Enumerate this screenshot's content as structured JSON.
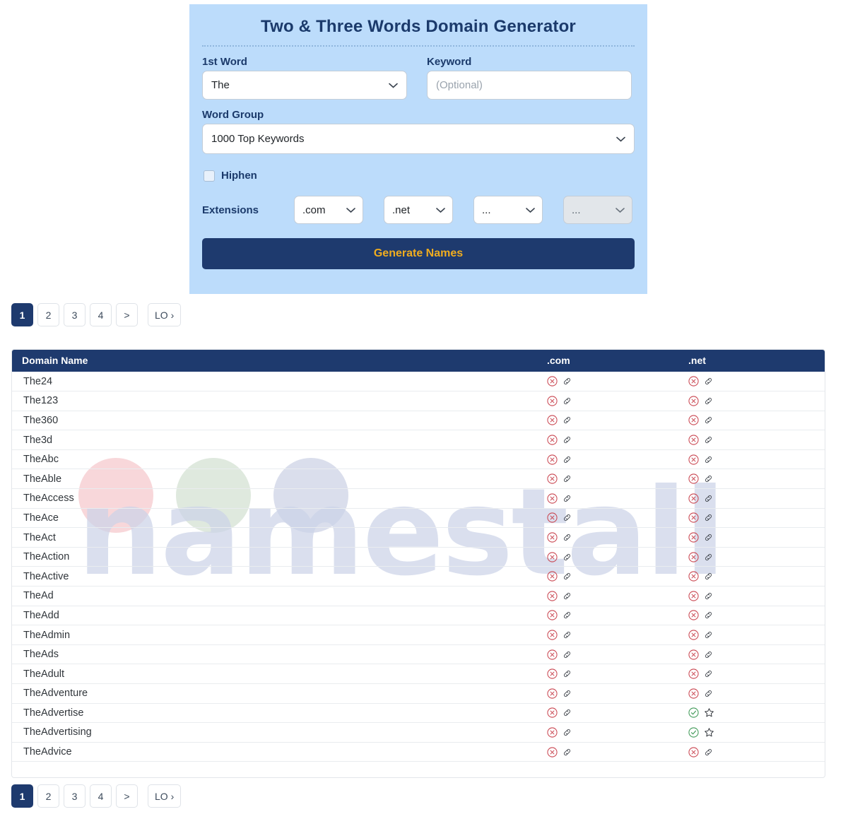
{
  "generator": {
    "title": "Two & Three Words Domain Generator",
    "first_word": {
      "label": "1st Word",
      "value": "The",
      "icon": "chevron-down-icon"
    },
    "keyword": {
      "label": "Keyword",
      "value": "",
      "placeholder": "(Optional)"
    },
    "word_group": {
      "label": "Word Group",
      "value": "1000 Top Keywords",
      "icon": "chevron-down-icon"
    },
    "hiphen": {
      "label": "Hiphen",
      "checked": false
    },
    "extensions": {
      "label": "Extensions",
      "selects": [
        {
          "value": ".com",
          "disabled": false
        },
        {
          "value": ".net",
          "disabled": false
        },
        {
          "value": "...",
          "disabled": false
        },
        {
          "value": "...",
          "disabled": true
        }
      ]
    },
    "generate_button": "Generate Names",
    "colors": {
      "panel_bg": "#bcdcfb",
      "accent_dark": "#1e3a6e",
      "button_text": "#f0ad1f"
    }
  },
  "pagination": {
    "pages": [
      "1",
      "2",
      "3",
      "4"
    ],
    "next_label": ">",
    "last_label": "LO ›",
    "active": "1"
  },
  "results": {
    "columns": [
      "Domain Name",
      ".com",
      ".net"
    ],
    "watermark": {
      "text": "namestall",
      "circle_colors": [
        "#f8d7da",
        "#dfe9de",
        "#dadeec"
      ]
    },
    "status_icons": {
      "taken": "circle-x-icon",
      "available": "circle-check-icon",
      "link": "link-icon",
      "favorite": "star-icon"
    },
    "rows": [
      {
        "domain": "The24",
        "com": "taken",
        "net": "taken"
      },
      {
        "domain": "The123",
        "com": "taken",
        "net": "taken"
      },
      {
        "domain": "The360",
        "com": "taken",
        "net": "taken"
      },
      {
        "domain": "The3d",
        "com": "taken",
        "net": "taken"
      },
      {
        "domain": "TheAbc",
        "com": "taken",
        "net": "taken"
      },
      {
        "domain": "TheAble",
        "com": "taken",
        "net": "taken"
      },
      {
        "domain": "TheAccess",
        "com": "taken",
        "net": "taken"
      },
      {
        "domain": "TheAce",
        "com": "taken",
        "net": "taken"
      },
      {
        "domain": "TheAct",
        "com": "taken",
        "net": "taken"
      },
      {
        "domain": "TheAction",
        "com": "taken",
        "net": "taken"
      },
      {
        "domain": "TheActive",
        "com": "taken",
        "net": "taken"
      },
      {
        "domain": "TheAd",
        "com": "taken",
        "net": "taken"
      },
      {
        "domain": "TheAdd",
        "com": "taken",
        "net": "taken"
      },
      {
        "domain": "TheAdmin",
        "com": "taken",
        "net": "taken"
      },
      {
        "domain": "TheAds",
        "com": "taken",
        "net": "taken"
      },
      {
        "domain": "TheAdult",
        "com": "taken",
        "net": "taken"
      },
      {
        "domain": "TheAdventure",
        "com": "taken",
        "net": "taken"
      },
      {
        "domain": "TheAdvertise",
        "com": "taken",
        "net": "available"
      },
      {
        "domain": "TheAdvertising",
        "com": "taken",
        "net": "available"
      },
      {
        "domain": "TheAdvice",
        "com": "taken",
        "net": "taken"
      }
    ]
  }
}
